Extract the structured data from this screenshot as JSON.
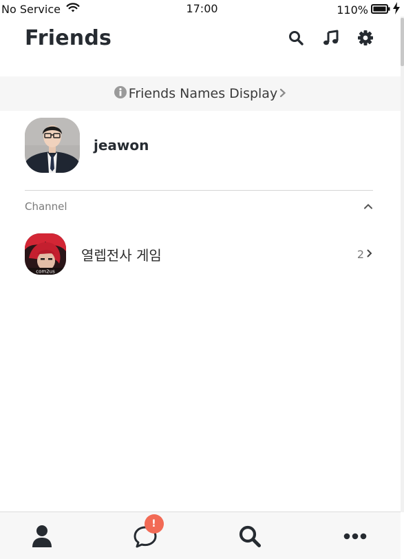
{
  "status_bar": {
    "carrier": "No Service",
    "time": "17:00",
    "battery": "110%"
  },
  "header": {
    "title": "Friends"
  },
  "banner": {
    "label": "Friends Names Display"
  },
  "profile": {
    "name": "jeawon"
  },
  "channel_section": {
    "label": "Channel",
    "items": [
      {
        "name": "열렙전사 게임",
        "count": "2",
        "logo_text": "com2us"
      }
    ]
  },
  "tab_bar": {
    "chats_badge": "!"
  },
  "colors": {
    "badge": "#f26a55",
    "title": "#262b31",
    "banner_bg": "#f6f6f6",
    "tab_bar_bg": "#f7f7f7"
  },
  "icons": [
    "wifi-icon",
    "battery-icon",
    "charging-icon",
    "search-icon",
    "music-icon",
    "settings-icon",
    "info-icon",
    "chevron-right-icon",
    "chevron-up-icon",
    "person-icon",
    "chat-icon",
    "more-icon"
  ]
}
